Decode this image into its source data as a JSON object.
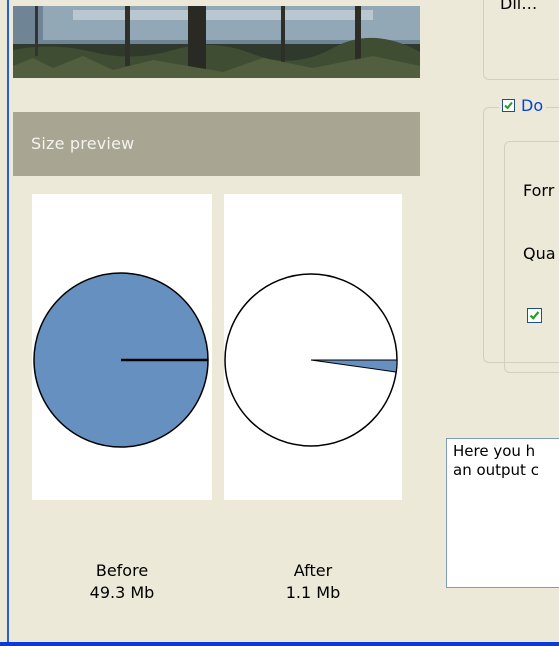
{
  "size_preview": {
    "header_label": "Size preview",
    "before": {
      "label": "Before",
      "size": "49.3 Mb",
      "fill_fraction": 1.0
    },
    "after": {
      "label": "After",
      "size": "1.1 Mb",
      "fill_fraction": 0.0223
    },
    "pie_fill_color": "#6690c0"
  },
  "options": {
    "top_group_partial_text": "Dii…",
    "checkbox_label": "Do",
    "checkbox_checked": true,
    "format_label": "Forr",
    "quality_label": "Qua",
    "option_checked": true
  },
  "info_text": "Here you h\nan output c",
  "colors": {
    "window_bg": "#ece9d8",
    "frame_blue": "#2a5fd0",
    "header_bar": "#a8a592",
    "checkbox_label_color": "#0046d5"
  }
}
